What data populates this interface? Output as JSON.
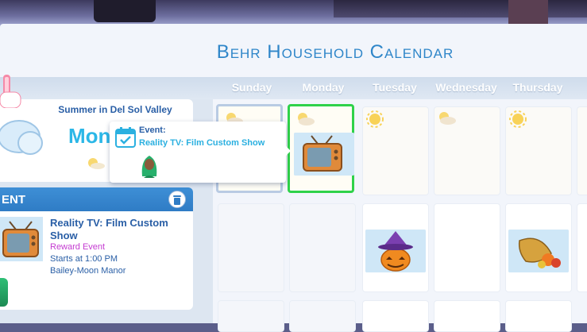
{
  "calendar": {
    "title": "Behr Household Calendar",
    "days": [
      "Sunday",
      "Monday",
      "Tuesday",
      "Wednesday",
      "Thursday"
    ]
  },
  "season": {
    "text": "Summer in Del Sol Valley",
    "month_label": "Mon"
  },
  "event_panel": {
    "header": "ENT",
    "name": "Reality TV: Film Custom Show",
    "type": "Reward Event",
    "start": "Starts at 1:00  PM",
    "location": "Bailey-Moon Manor"
  },
  "tooltip": {
    "label": "Event:",
    "value": "Reality TV: Film Custom Show"
  },
  "icons": {
    "trash": "trash-icon",
    "calendar": "calendar-check-icon",
    "tv": "tv-icon",
    "pumpkin": "pumpkin-icon",
    "cornucopia": "cornucopia-icon",
    "sun": "sun-icon",
    "cloud": "cloud-icon"
  },
  "colors": {
    "title": "#2f86c9",
    "today_border": "#2fd24a",
    "reward": "#c43bd1",
    "accent": "#2bb0e0"
  }
}
